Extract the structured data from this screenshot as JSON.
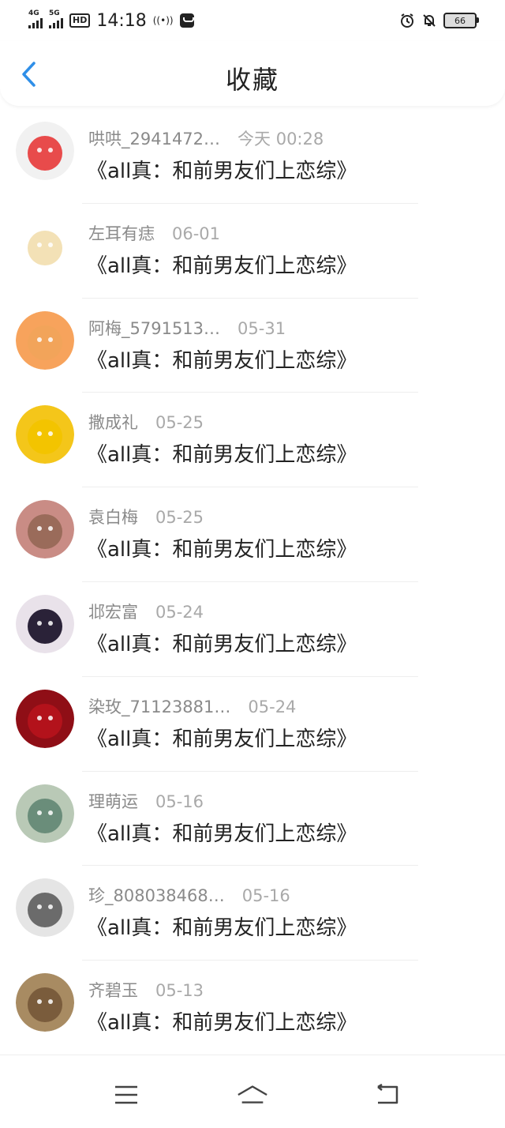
{
  "status_bar": {
    "signal1": "4G",
    "signal2": "5G",
    "hd": "HD",
    "time": "14:18",
    "battery": "66"
  },
  "header": {
    "title": "收藏"
  },
  "items": [
    {
      "user": "哄哄_2941472…",
      "date": "今天 00:28",
      "title": "《all真：和前男友们上恋综》",
      "avatar_color": "#e84b4b",
      "avatar_bg": "#f1f1f1"
    },
    {
      "user": "左耳有痣",
      "date": "06-01",
      "title": "《all真：和前男友们上恋综》",
      "avatar_color": "#f3e1b6",
      "avatar_bg": "#ffffff"
    },
    {
      "user": "阿梅_5791513…",
      "date": "05-31",
      "title": "《all真：和前男友们上恋综》",
      "avatar_color": "#f2a45a",
      "avatar_bg": "#f7a35c"
    },
    {
      "user": "撒成礼",
      "date": "05-25",
      "title": "《all真：和前男友们上恋综》",
      "avatar_color": "#f3c400",
      "avatar_bg": "#f4c61a"
    },
    {
      "user": "袁白梅",
      "date": "05-25",
      "title": "《all真：和前男友们上恋综》",
      "avatar_color": "#9a6b5a",
      "avatar_bg": "#c98c85"
    },
    {
      "user": "邶宏富",
      "date": "05-24",
      "title": "《all真：和前男友们上恋综》",
      "avatar_color": "#2a2238",
      "avatar_bg": "#e9e2ea"
    },
    {
      "user": "染玫_71123881…",
      "date": "05-24",
      "title": "《all真：和前男友们上恋综》",
      "avatar_color": "#b3121b",
      "avatar_bg": "#8f0e16"
    },
    {
      "user": "理萌运",
      "date": "05-16",
      "title": "《all真：和前男友们上恋综》",
      "avatar_color": "#6a8d7a",
      "avatar_bg": "#b9c9b6"
    },
    {
      "user": "珍_808038468…",
      "date": "05-16",
      "title": "《all真：和前男友们上恋综》",
      "avatar_color": "#6b6b6b",
      "avatar_bg": "#e5e5e5"
    },
    {
      "user": "齐碧玉",
      "date": "05-13",
      "title": "《all真：和前男友们上恋综》",
      "avatar_color": "#7a5c3c",
      "avatar_bg": "#a88b62"
    }
  ],
  "colors": {
    "accent": "#2f8fe8",
    "text": "#222222",
    "meta": "#8a8a8a"
  }
}
